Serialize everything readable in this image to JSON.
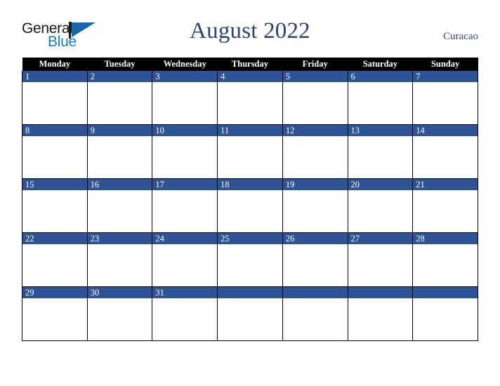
{
  "brand": {
    "name_line1": "General",
    "name_line2": "Blue",
    "mark": "triangle-logo-icon"
  },
  "header": {
    "title": "August 2022",
    "country": "Curacao"
  },
  "colors": {
    "day_band": "#2f5496",
    "header_row": "#000000",
    "title_text": "#2e4372",
    "brand_blue": "#1a7cc4",
    "page_background": "#fdfdfd"
  },
  "calendar": {
    "weekday_headers": [
      "Monday",
      "Tuesday",
      "Wednesday",
      "Thursday",
      "Friday",
      "Saturday",
      "Sunday"
    ],
    "weeks": [
      [
        "1",
        "2",
        "3",
        "4",
        "5",
        "6",
        "7"
      ],
      [
        "8",
        "9",
        "10",
        "11",
        "12",
        "13",
        "14"
      ],
      [
        "15",
        "16",
        "17",
        "18",
        "19",
        "20",
        "21"
      ],
      [
        "22",
        "23",
        "24",
        "25",
        "26",
        "27",
        "28"
      ],
      [
        "29",
        "30",
        "31",
        "",
        "",
        "",
        ""
      ]
    ]
  }
}
